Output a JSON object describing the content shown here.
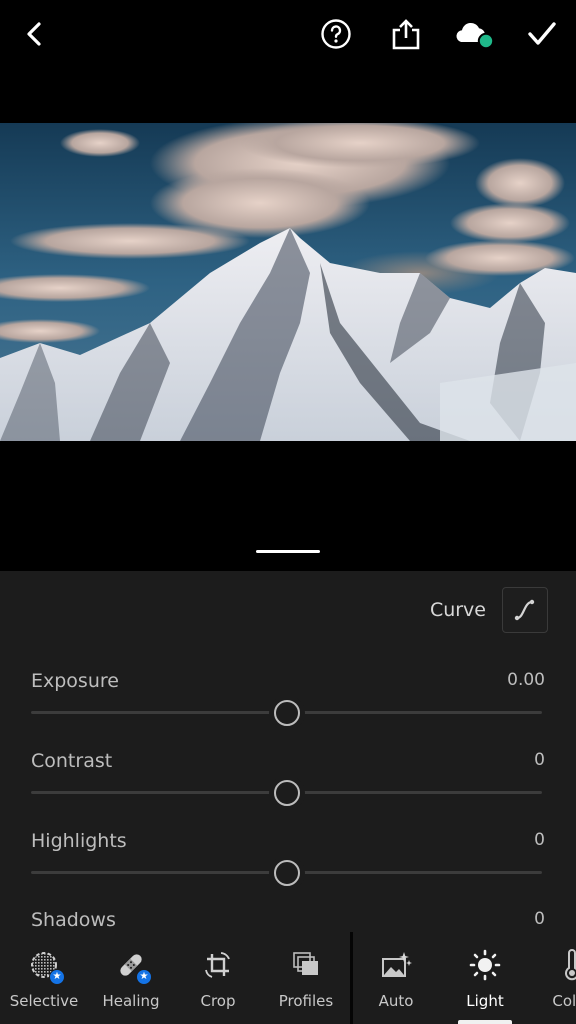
{
  "topbar": {
    "back": {
      "icon": "chevron-left-icon"
    },
    "help": {
      "icon": "help-circle-icon"
    },
    "share": {
      "icon": "share-icon"
    },
    "cloud_sync": {
      "icon": "cloud-icon",
      "status": "synced",
      "status_color": "#1fb98a"
    },
    "done": {
      "icon": "checkmark-icon"
    }
  },
  "photo": {
    "description": "Snow-covered mountain peak under a blue sky with clouds"
  },
  "panel": {
    "curve_label": "Curve",
    "curve_icon": "tone-curve-icon",
    "sliders": [
      {
        "label": "Exposure",
        "value": "0.00",
        "position": 0.5
      },
      {
        "label": "Contrast",
        "value": "0",
        "position": 0.5
      },
      {
        "label": "Highlights",
        "value": "0",
        "position": 0.5
      },
      {
        "label": "Shadows",
        "value": "0",
        "position": 0.5
      }
    ]
  },
  "toolbar": {
    "tools": [
      {
        "label": "Selective",
        "icon": "selective-brush-icon",
        "premium": true
      },
      {
        "label": "Healing",
        "icon": "healing-bandage-icon",
        "premium": true
      },
      {
        "label": "Crop",
        "icon": "crop-rotate-icon",
        "premium": false
      },
      {
        "label": "Profiles",
        "icon": "profiles-icon",
        "premium": false
      },
      {
        "label": "Auto",
        "icon": "auto-enhance-icon",
        "premium": false
      },
      {
        "label": "Light",
        "icon": "sun-icon",
        "premium": false,
        "active": true
      },
      {
        "label": "Color",
        "icon": "thermometer-icon",
        "premium": false
      }
    ],
    "premium_badge_color": "#1473e6"
  }
}
